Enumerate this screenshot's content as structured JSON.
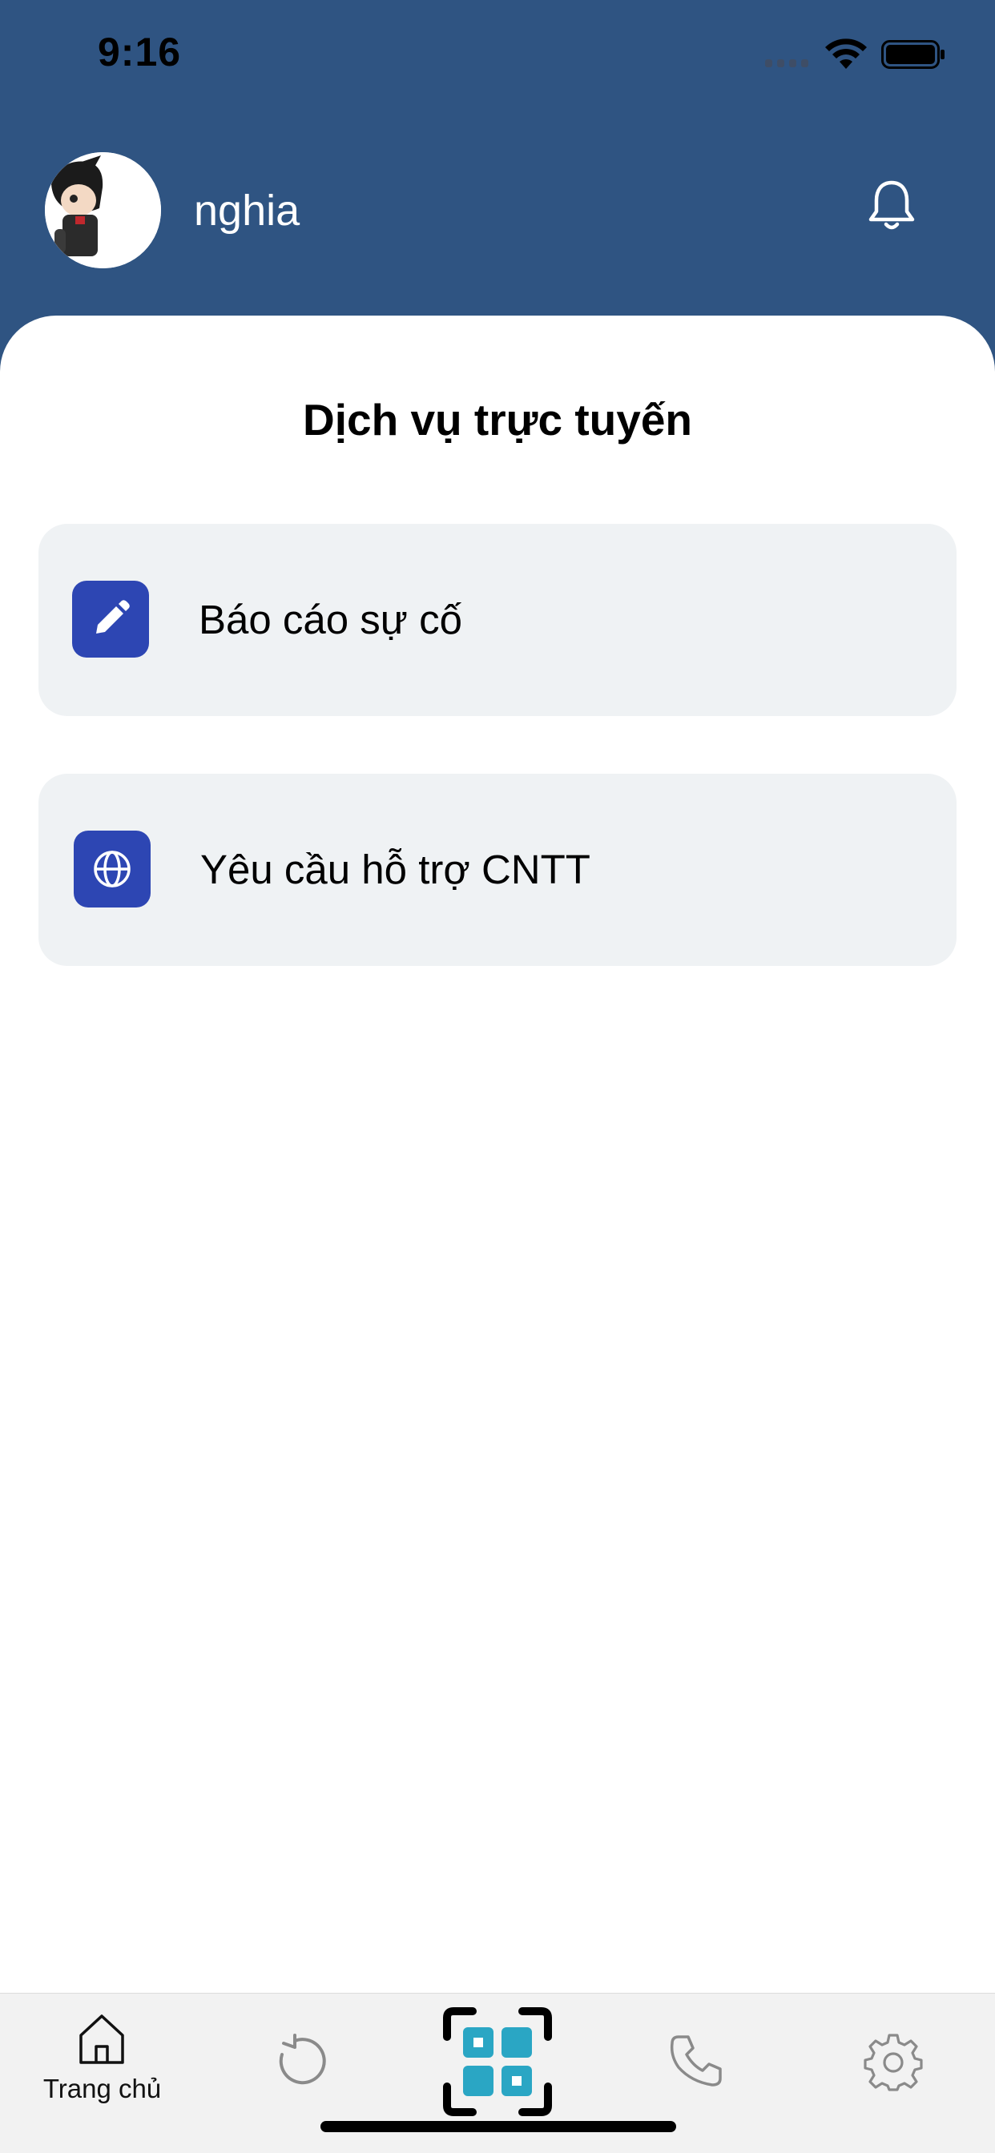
{
  "status_bar": {
    "time": "9:16"
  },
  "header": {
    "username": "nghia",
    "avatar_icon": "avatar-cartoon-icon",
    "notification_icon": "bell-icon"
  },
  "main": {
    "title": "Dịch vụ trực tuyến",
    "services": [
      {
        "label": "Báo cáo sự cố",
        "icon": "pencil-icon"
      },
      {
        "label": "Yêu cầu hỗ trợ CNTT",
        "icon": "globe-icon"
      }
    ]
  },
  "bottom_nav": {
    "items": [
      {
        "label": "Trang chủ",
        "icon": "home-icon",
        "active": true
      },
      {
        "label": "",
        "icon": "history-icon"
      },
      {
        "label": "",
        "icon": "qr-scan-icon"
      },
      {
        "label": "",
        "icon": "phone-icon"
      },
      {
        "label": "",
        "icon": "gear-icon"
      }
    ]
  },
  "colors": {
    "header_bg": "#2f5482",
    "card_bg": "#eff2f4",
    "icon_tile": "#2d46b3",
    "scan_accent": "#2aa6c4"
  }
}
